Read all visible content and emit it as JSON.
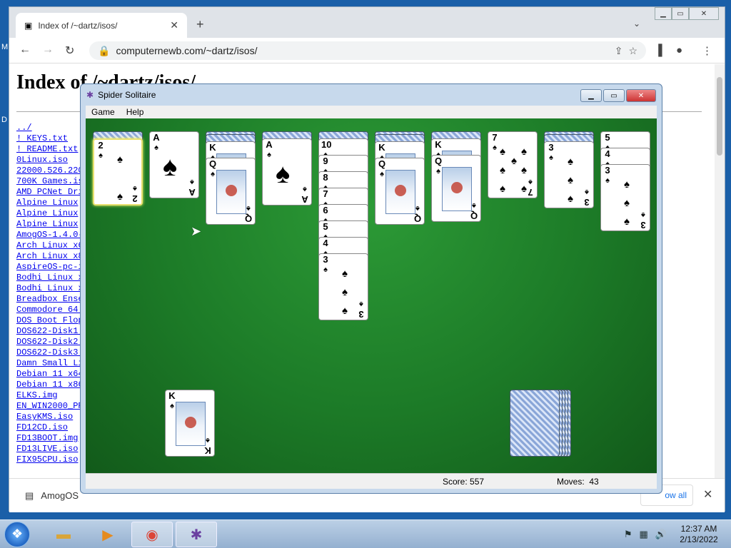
{
  "desktop": {
    "labels": [
      "M",
      "D"
    ]
  },
  "browser": {
    "tab_title": "Index of /~dartz/isos/",
    "url": "computernewb.com/~dartz/isos/",
    "page_heading": "Index of /~dartz/isos/",
    "files": [
      "../",
      "! KEYS.txt",
      "! README.txt",
      "0Linux.iso",
      "22000.526.220",
      "700K Games.is",
      "AMD PCNet Dri",
      "Alpine Linux",
      "Alpine Linux",
      "Alpine Linux",
      "AmogOS-1.4.0-",
      "Arch Linux x6",
      "Arch Linux x8",
      "AspireOS-pc-i",
      "Bodhi Linux x",
      "Bodhi Linux x",
      "Breadbox Ense",
      "Commodore 64.",
      "DOS Boot Flop",
      "DOS622-Disk1.",
      "DOS622-Disk2.",
      "DOS622-Disk3.",
      "Damn Small Li",
      "Debian 11 x64",
      "Debian 11 x86",
      "ELKS.img",
      "EN_WIN2000_PR",
      "EasyKMS.iso",
      "FD12CD.iso",
      "FD13BOOT.img",
      "FD13LIVE.iso",
      "FIX95CPU.iso"
    ],
    "download_item": "AmogOS",
    "show_all": "ow all"
  },
  "spider": {
    "title": "Spider Solitaire",
    "menu": [
      "Game",
      "Help"
    ],
    "score_label": "Score:",
    "score": "557",
    "moves_label": "Moves:",
    "moves": "43",
    "colors": {
      "felt": "#1c7a27",
      "card_back": "#8aa6d8"
    },
    "columns": [
      {
        "face_down": 1,
        "cards": [
          "2"
        ],
        "highlight": true
      },
      {
        "face_down": 0,
        "cards": [
          "A"
        ]
      },
      {
        "face_down": 2,
        "cards": [
          "K",
          "Q"
        ]
      },
      {
        "face_down": 1,
        "cards": [
          "A"
        ]
      },
      {
        "face_down": 1,
        "cards": [
          "10",
          "9",
          "8",
          "7",
          "6",
          "5",
          "4",
          "3"
        ]
      },
      {
        "face_down": 2,
        "cards": [
          "K",
          "Q"
        ]
      },
      {
        "face_down": 1,
        "cards": [
          "K",
          "Q"
        ]
      },
      {
        "face_down": 0,
        "cards": [
          "7"
        ]
      },
      {
        "face_down": 2,
        "cards": [
          "3"
        ]
      },
      {
        "face_down": 0,
        "cards": [
          "5",
          "4",
          "3"
        ]
      }
    ],
    "completed_suit_top": "K",
    "stock_piles": 5,
    "suit": "♠"
  },
  "taskbar": {
    "time": "12:37 AM",
    "date": "2/13/2022",
    "start_icon": "windows-start-icon",
    "items": [
      "file-explorer-icon",
      "media-player-icon",
      "chrome-icon",
      "spider-solitaire-icon"
    ]
  }
}
